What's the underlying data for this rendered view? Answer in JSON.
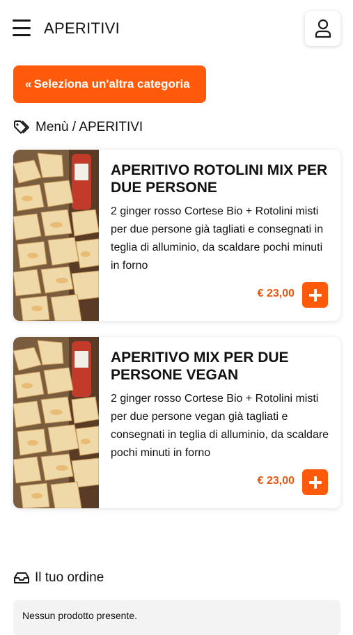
{
  "header": {
    "title": "APERITIVI",
    "menu_icon": "hamburger-menu-icon",
    "user_icon": "user-icon"
  },
  "category_button": {
    "label": "Seleziona un'altra categoria",
    "icon": "double-chevron-left-icon"
  },
  "breadcrumb": {
    "icon": "tags-icon",
    "text": "Menù / APERITIVI"
  },
  "products": [
    {
      "title": "APERITIVO ROTOLINI MIX PER DUE PERSONE",
      "description": "2 ginger rosso Cortese Bio + Rotolini misti per due persone già tagliati e consegnati in teglia di alluminio, da scaldare pochi minuti in forno",
      "price": "€ 23,00"
    },
    {
      "title": "APERITIVO MIX PER DUE PERSONE VEGAN",
      "description": "2 ginger rosso Cortese Bio + Rotolini misti per due persone vegan già tagliati e consegnati in teglia di alluminio, da scaldare pochi minuti in forno",
      "price": "€ 23,00"
    }
  ],
  "order": {
    "icon": "inbox-tray-icon",
    "heading": "Il tuo ordine",
    "empty_text": "Nessun prodotto presente."
  },
  "colors": {
    "accent": "#ff5a0a",
    "price": "#e8560f",
    "order_box_bg": "#f3f3f3"
  }
}
